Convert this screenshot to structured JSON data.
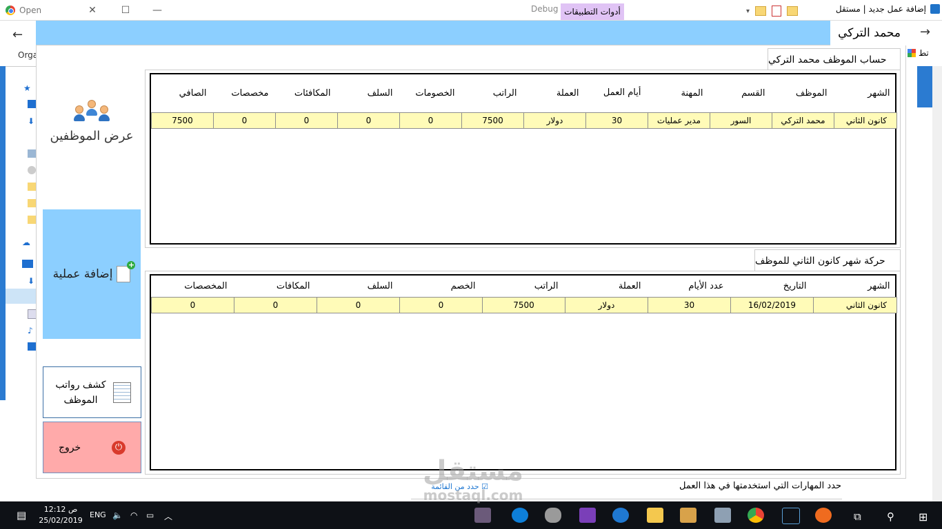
{
  "window": {
    "chrome_tab": "Open",
    "debug_label": "Debug",
    "app_tools_tab": "أدوات التطبيقات",
    "explorer_title": "إضافة عمل جديد | مستقل",
    "left_org": "Orga",
    "right_bookmarks": "تط"
  },
  "app": {
    "title": "محمد التركي",
    "sidebar": {
      "show_employees": "عرض الموظفين",
      "add_operation": "إضافة عملية",
      "payroll": "كشف رواتب الموظف",
      "exit": "خروج"
    },
    "account_panel": {
      "title": "حساب الموظف محمد التركي",
      "columns": [
        "الشهر",
        "الموظف",
        "القسم",
        "المهنة",
        "أيام العمل",
        "العملة",
        "الراتب",
        "الخصومات",
        "السلف",
        "المكافئات",
        "مخصصات",
        "الصافي"
      ],
      "rows": [
        [
          "كانون الثاني",
          "محمد التركي",
          "السور",
          "مدير عمليات",
          "30",
          "دولار",
          "7500",
          "0",
          "0",
          "0",
          "0",
          "7500"
        ]
      ]
    },
    "movement_panel": {
      "title": "حركة شهر  كانون الثاني للموظف",
      "columns": [
        "الشهر",
        "التاريخ",
        "عدد الأيام",
        "العملة",
        "الراتب",
        "الخصم",
        "السلف",
        "المكافات",
        "المخصصات"
      ],
      "rows": [
        [
          "كانون الثاني",
          "16/02/2019",
          "30",
          "دولار",
          "7500",
          "0",
          "0",
          "0",
          "0"
        ]
      ]
    }
  },
  "background_page": {
    "skills_prompt": "حدد المهارات التي استخدمتها في هذا العمل",
    "pick_from_list": "حدد من القائمة"
  },
  "taskbar": {
    "time": "12:12 ص",
    "date": "25/02/2019",
    "language": "ENG"
  },
  "watermark": {
    "arabic": "مستقل",
    "latin": "mostaql.com"
  },
  "colors": {
    "header_blue": "#8ccfff",
    "row_highlight": "#fffbb8",
    "exit_red": "#ffaaaa",
    "taskbar": "#0e1116"
  }
}
